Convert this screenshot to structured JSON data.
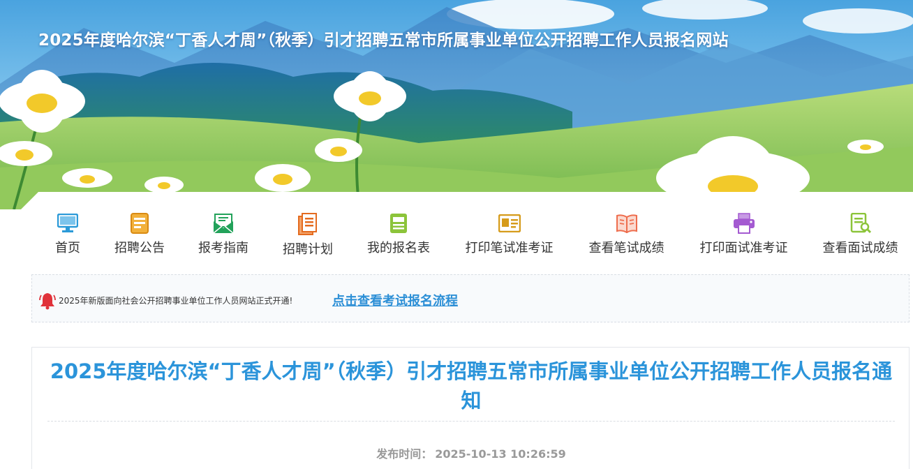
{
  "header": {
    "site_title": "2025年度哈尔滨“丁香人才周”（秋季）引才招聘五常市所属事业单位公开招聘工作人员报名网站"
  },
  "nav": {
    "items": [
      {
        "label": "首页",
        "icon": "monitor-icon",
        "color": "#2b9ad8"
      },
      {
        "label": "招聘公告",
        "icon": "announcement-icon",
        "color": "#e39a1f"
      },
      {
        "label": "报考指南",
        "icon": "envelope-icon",
        "color": "#22a25a"
      },
      {
        "label": "招聘计划",
        "icon": "document-icon",
        "color": "#e46b1f"
      },
      {
        "label": "我的报名表",
        "icon": "form-icon",
        "color": "#8cc43a"
      },
      {
        "label": "打印笔试准考证",
        "icon": "id-card-icon",
        "color": "#d69b1a"
      },
      {
        "label": "查看笔试成绩",
        "icon": "book-icon",
        "color": "#ee6d4d"
      },
      {
        "label": "打印面试准考证",
        "icon": "printer-icon",
        "color": "#a45ad1"
      },
      {
        "label": "查看面试成绩",
        "icon": "search-document-icon",
        "color": "#8cc43a"
      }
    ]
  },
  "notice": {
    "text": "2025年新版面向社会公开招聘事业单位工作人员网站正式开通!",
    "link_label": "点击查看考试报名流程",
    "icon": "bell-icon",
    "icon_color": "#e0323a"
  },
  "article": {
    "title": "2025年度哈尔滨“丁香人才周”（秋季）引才招聘五常市所属事业单位公开招聘工作人员报名通知",
    "publish_label": "发布时间：",
    "publish_time": "2025-10-13 10:26:59"
  },
  "colors": {
    "accent": "#2b94da",
    "link": "#2c8fd6"
  }
}
